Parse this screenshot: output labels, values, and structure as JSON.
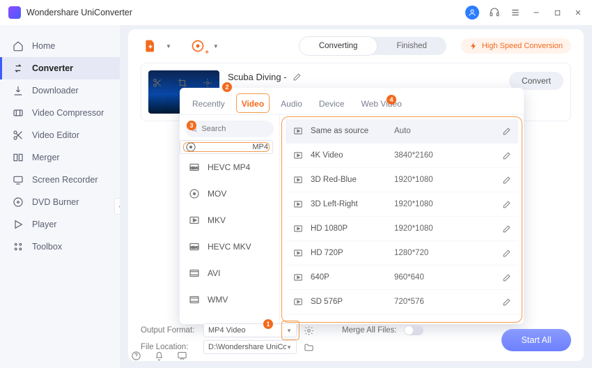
{
  "app": {
    "title": "Wondershare UniConverter"
  },
  "sidebar": {
    "items": [
      {
        "label": "Home",
        "icon": "home"
      },
      {
        "label": "Converter",
        "icon": "converter"
      },
      {
        "label": "Downloader",
        "icon": "download"
      },
      {
        "label": "Video Compressor",
        "icon": "compress"
      },
      {
        "label": "Video Editor",
        "icon": "editor"
      },
      {
        "label": "Merger",
        "icon": "merger"
      },
      {
        "label": "Screen Recorder",
        "icon": "recorder"
      },
      {
        "label": "DVD Burner",
        "icon": "dvd"
      },
      {
        "label": "Player",
        "icon": "player"
      },
      {
        "label": "Toolbox",
        "icon": "toolbox"
      }
    ],
    "active_index": 1
  },
  "toolbar": {
    "segments": [
      "Converting",
      "Finished"
    ],
    "active_segment": 0,
    "hsc": "High Speed Conversion"
  },
  "card": {
    "title": "Scuba Diving -",
    "convert": "Convert"
  },
  "popup": {
    "tabs": [
      "Recently",
      "Video",
      "Audio",
      "Device",
      "Web Video"
    ],
    "active_tab": 1,
    "search_placeholder": "Search",
    "formats": [
      "MP4",
      "HEVC MP4",
      "MOV",
      "MKV",
      "HEVC MKV",
      "AVI",
      "WMV"
    ],
    "selected_format": 0,
    "presets": [
      {
        "name": "Same as source",
        "res": "Auto"
      },
      {
        "name": "4K Video",
        "res": "3840*2160"
      },
      {
        "name": "3D Red-Blue",
        "res": "1920*1080"
      },
      {
        "name": "3D Left-Right",
        "res": "1920*1080"
      },
      {
        "name": "HD 1080P",
        "res": "1920*1080"
      },
      {
        "name": "HD 720P",
        "res": "1280*720"
      },
      {
        "name": "640P",
        "res": "960*640"
      },
      {
        "name": "SD 576P",
        "res": "720*576"
      }
    ]
  },
  "bottom": {
    "output_format_label": "Output Format:",
    "output_format_value": "MP4 Video",
    "file_location_label": "File Location:",
    "file_location_value": "D:\\Wondershare UniConverter",
    "merge_label": "Merge All Files:",
    "start_all": "Start All"
  },
  "badges": {
    "b1": "1",
    "b2": "2",
    "b3": "3",
    "b4": "4"
  }
}
